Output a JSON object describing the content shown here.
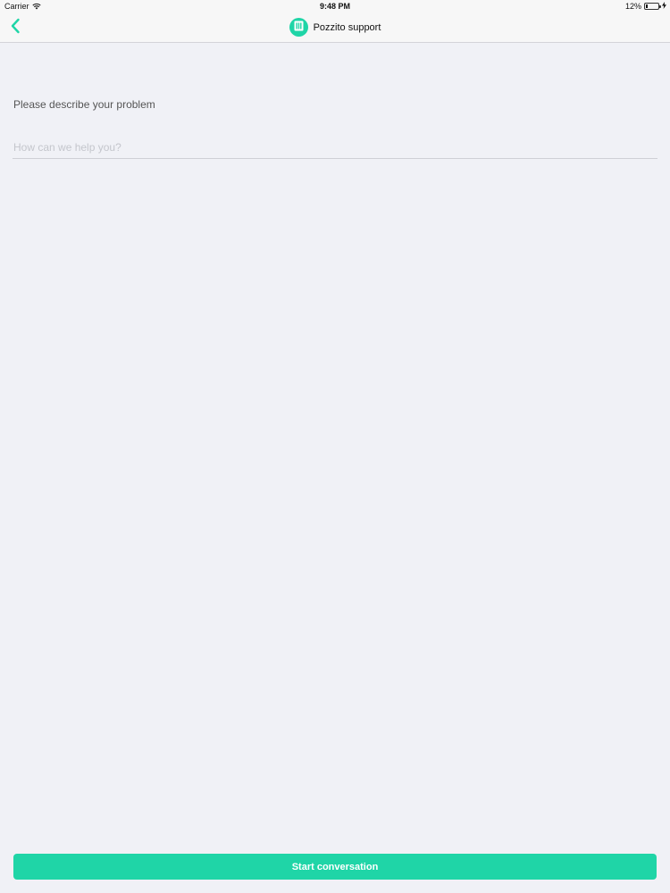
{
  "status_bar": {
    "carrier": "Carrier",
    "time": "9:48 PM",
    "battery_percent": "12%",
    "battery_level": 0.12,
    "icons": [
      "wifi-icon",
      "battery-icon",
      "charging-bolt-icon"
    ]
  },
  "nav": {
    "title": "Pozzito support",
    "back_icon": "chevron-left-icon",
    "avatar_icon": "document-icon",
    "accent_color": "#1fd5a7"
  },
  "form": {
    "label": "Please describe your problem",
    "input_value": "",
    "input_placeholder": "How can we help you?"
  },
  "actions": {
    "start_label": "Start conversation"
  },
  "colors": {
    "accent": "#1fd5a7",
    "background": "#f0f1f6"
  }
}
